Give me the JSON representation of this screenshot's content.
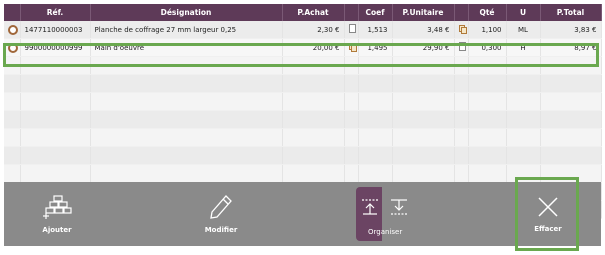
{
  "table": {
    "headers": [
      "",
      "Réf.",
      "Désignation",
      "P.Achat",
      "",
      "Coef",
      "P.Unitaire",
      "",
      "Qté",
      "U",
      "P.Total"
    ],
    "rows": [
      {
        "ref": "1477110000003",
        "designation": "Planche de coffrage 27 mm largeur 0,25",
        "p_achat": "2,30 €",
        "coef": "1,513",
        "p_unitaire": "3,48 €",
        "qte": "1,100",
        "u": "ML",
        "p_total": "3,83 €"
      },
      {
        "ref": "9900000000999",
        "designation": "Main d'oeuvre",
        "p_achat": "20,00 €",
        "coef": "1,495",
        "p_unitaire": "29,90 €",
        "qte": "0,300",
        "u": "H",
        "p_total": "8,97 €"
      }
    ],
    "empty_rows": 9
  },
  "toolbar": {
    "add_label": "Ajouter",
    "edit_label": "Modifier",
    "organize_label": "Organiser",
    "delete_label": "Effacer"
  },
  "colors": {
    "header_bg": "#5e3a58",
    "toolbar_bg": "#8a8a8a",
    "highlight": "#6aa84f",
    "organize_active": "#6b4463"
  },
  "icons": {
    "row_select": "radio-dot-icon",
    "note": "document-icon",
    "price_copy": "copy-icon",
    "add": "add-bricks-icon",
    "edit": "pencil-icon",
    "organize_up": "move-up-icon",
    "organize_down": "move-down-icon",
    "delete": "close-icon"
  }
}
